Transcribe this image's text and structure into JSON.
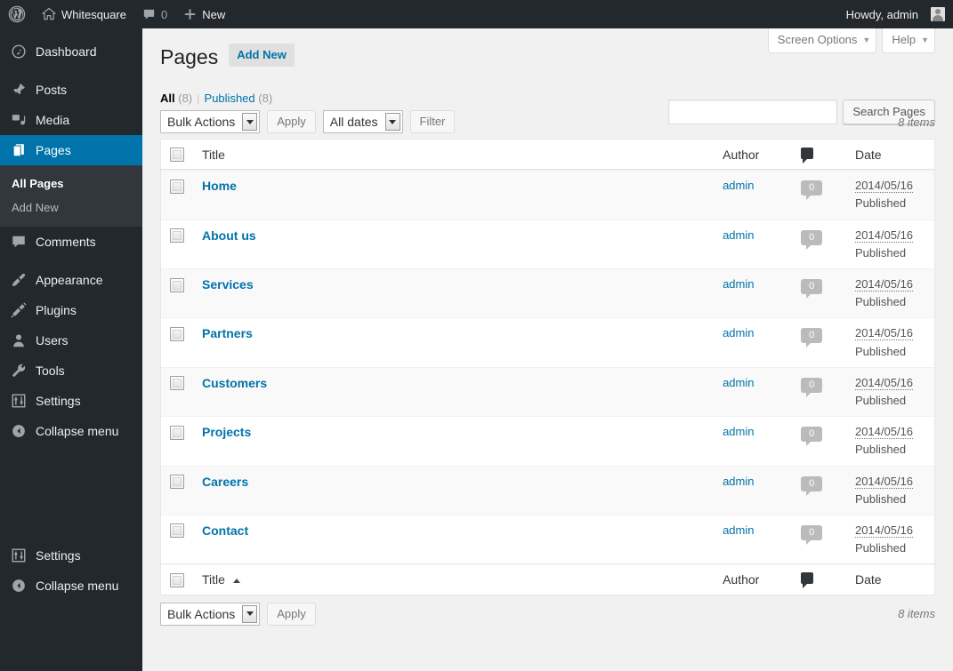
{
  "adminbar": {
    "logo_icon": "wordpress-logo-icon",
    "site_name": "Whitesquare",
    "site_icon": "home-icon",
    "comments_icon": "comment-icon",
    "comments_count": "0",
    "new_icon": "plus-icon",
    "new_label": "New",
    "howdy": "Howdy, admin",
    "avatar_icon": "avatar-icon"
  },
  "sidebar": {
    "items": [
      {
        "label": "Dashboard",
        "icon": "dashboard-icon",
        "name": "dashboard"
      },
      {
        "label": "Posts",
        "icon": "pin-icon",
        "name": "posts"
      },
      {
        "label": "Media",
        "icon": "media-icon",
        "name": "media"
      },
      {
        "label": "Pages",
        "icon": "pages-icon",
        "name": "pages",
        "current": true
      },
      {
        "label": "Comments",
        "icon": "comment-icon",
        "name": "comments"
      },
      {
        "label": "Appearance",
        "icon": "brush-icon",
        "name": "appearance"
      },
      {
        "label": "Plugins",
        "icon": "plug-icon",
        "name": "plugins"
      },
      {
        "label": "Users",
        "icon": "user-icon",
        "name": "users"
      },
      {
        "label": "Tools",
        "icon": "wrench-icon",
        "name": "tools"
      },
      {
        "label": "Settings",
        "icon": "settings-icon",
        "name": "settings"
      },
      {
        "label": "Collapse menu",
        "icon": "collapse-icon",
        "name": "collapse-menu"
      }
    ],
    "submenu": [
      {
        "label": "All Pages",
        "current": true
      },
      {
        "label": "Add New",
        "current": false
      }
    ],
    "repeat_items": [
      {
        "label": "Settings",
        "icon": "settings-icon",
        "name": "settings"
      },
      {
        "label": "Collapse menu",
        "icon": "collapse-icon",
        "name": "collapse-menu"
      }
    ]
  },
  "screen_meta": {
    "screen_options": "Screen Options",
    "help": "Help",
    "caret": "▼"
  },
  "page": {
    "title": "Pages",
    "add_new": "Add New"
  },
  "views": {
    "all_label": "All",
    "all_count": "(8)",
    "divider": "|",
    "published_label": "Published",
    "published_count": "(8)"
  },
  "search": {
    "value": "",
    "placeholder": "",
    "button": "Search Pages"
  },
  "tablenav_top": {
    "bulk_actions": "Bulk Actions",
    "apply": "Apply",
    "date_filter": "All dates",
    "filter": "Filter",
    "items": "8 items"
  },
  "tablenav_bottom": {
    "bulk_actions": "Bulk Actions",
    "apply": "Apply",
    "items": "8 items"
  },
  "table": {
    "columns": {
      "title": "Title",
      "author": "Author",
      "comments_icon": "comment-icon",
      "date": "Date"
    },
    "footer_columns": {
      "title": "Title",
      "sort": "▲",
      "author": "Author",
      "comments_icon": "comment-icon",
      "date": "Date"
    },
    "rows": [
      {
        "title": "Home",
        "author": "admin",
        "comments": "0",
        "date": "2014/05/16",
        "status": "Published"
      },
      {
        "title": "About us",
        "author": "admin",
        "comments": "0",
        "date": "2014/05/16",
        "status": "Published"
      },
      {
        "title": "Services",
        "author": "admin",
        "comments": "0",
        "date": "2014/05/16",
        "status": "Published"
      },
      {
        "title": "Partners",
        "author": "admin",
        "comments": "0",
        "date": "2014/05/16",
        "status": "Published"
      },
      {
        "title": "Customers",
        "author": "admin",
        "comments": "0",
        "date": "2014/05/16",
        "status": "Published"
      },
      {
        "title": "Projects",
        "author": "admin",
        "comments": "0",
        "date": "2014/05/16",
        "status": "Published"
      },
      {
        "title": "Careers",
        "author": "admin",
        "comments": "0",
        "date": "2014/05/16",
        "status": "Published"
      },
      {
        "title": "Contact",
        "author": "admin",
        "comments": "0",
        "date": "2014/05/16",
        "status": "Published"
      }
    ]
  },
  "colors": {
    "admin_dark": "#23282d",
    "submenu_dark": "#32373c",
    "accent_blue": "#0073aa",
    "page_bg": "#f1f1f1",
    "row_alt": "#f9f9f9"
  }
}
